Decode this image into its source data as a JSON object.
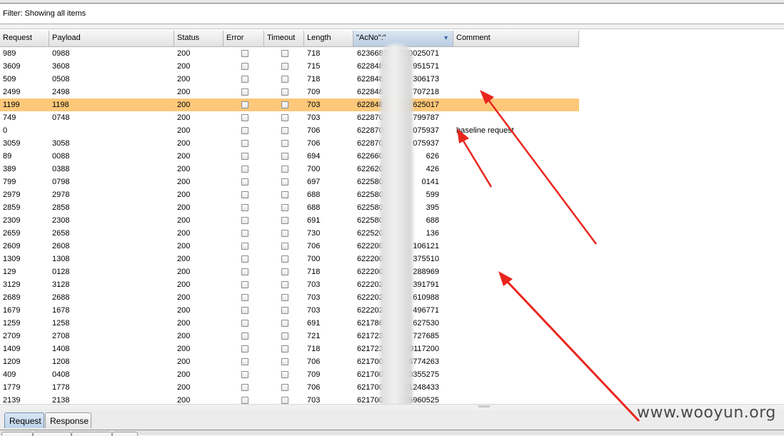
{
  "filter": {
    "label": "Filter: Showing all items"
  },
  "columns": [
    "Request",
    "Payload",
    "Status",
    "Error",
    "Timeout",
    "Length",
    "\"AcNo\":\"",
    "Comment"
  ],
  "selected_row_index": 4,
  "rows": [
    {
      "request": "989",
      "payload": "0988",
      "status": "200",
      "length": "718",
      "acno_start": "6236680",
      "acno_end": "020025071",
      "comment": ""
    },
    {
      "request": "3609",
      "payload": "3608",
      "status": "200",
      "length": "715",
      "acno_start": "6228481",
      "acno_end": "951571",
      "comment": ""
    },
    {
      "request": "509",
      "payload": "0508",
      "status": "200",
      "length": "718",
      "acno_start": "622848",
      "acno_end": "306173",
      "comment": ""
    },
    {
      "request": "2499",
      "payload": "2498",
      "status": "200",
      "length": "709",
      "acno_start": "622848",
      "acno_end": "707218",
      "comment": ""
    },
    {
      "request": "1199",
      "payload": "1198",
      "status": "200",
      "length": "703",
      "acno_start": "622848",
      "acno_end": "625017",
      "comment": ""
    },
    {
      "request": "749",
      "payload": "0748",
      "status": "200",
      "length": "703",
      "acno_start": "622870",
      "acno_end": "799787",
      "comment": ""
    },
    {
      "request": "0",
      "payload": "",
      "status": "200",
      "length": "706",
      "acno_start": "622870",
      "acno_end": "075937",
      "comment": "baseline request"
    },
    {
      "request": "3059",
      "payload": "3058",
      "status": "200",
      "length": "706",
      "acno_start": "622870",
      "acno_end": "075937",
      "comment": ""
    },
    {
      "request": "89",
      "payload": "0088",
      "status": "200",
      "length": "694",
      "acno_start": "622660",
      "acno_end": "626",
      "comment": ""
    },
    {
      "request": "389",
      "payload": "0388",
      "status": "200",
      "length": "700",
      "acno_start": "622620",
      "acno_end": "426",
      "comment": ""
    },
    {
      "request": "799",
      "payload": "0798",
      "status": "200",
      "length": "697",
      "acno_start": "622580",
      "acno_end": "0141",
      "comment": ""
    },
    {
      "request": "2979",
      "payload": "2978",
      "status": "200",
      "length": "688",
      "acno_start": "622580",
      "acno_end": "599",
      "comment": ""
    },
    {
      "request": "2859",
      "payload": "2858",
      "status": "200",
      "length": "688",
      "acno_start": "622580",
      "acno_end": "395",
      "comment": ""
    },
    {
      "request": "2309",
      "payload": "2308",
      "status": "200",
      "length": "691",
      "acno_start": "622580",
      "acno_end": "688",
      "comment": ""
    },
    {
      "request": "2659",
      "payload": "2658",
      "status": "200",
      "length": "730",
      "acno_start": "622520",
      "acno_end": "136",
      "comment": ""
    },
    {
      "request": "2609",
      "payload": "2608",
      "status": "200",
      "length": "706",
      "acno_start": "622200",
      "acno_end": "106121",
      "comment": ""
    },
    {
      "request": "1309",
      "payload": "1308",
      "status": "200",
      "length": "700",
      "acno_start": "622200",
      "acno_end": "375510",
      "comment": ""
    },
    {
      "request": "129",
      "payload": "0128",
      "status": "200",
      "length": "718",
      "acno_start": "622200",
      "acno_end": "288969",
      "comment": ""
    },
    {
      "request": "3129",
      "payload": "3128",
      "status": "200",
      "length": "703",
      "acno_start": "622202",
      "acno_end": "391791",
      "comment": ""
    },
    {
      "request": "2689",
      "payload": "2688",
      "status": "200",
      "length": "703",
      "acno_start": "622202",
      "acno_end": "610988",
      "comment": ""
    },
    {
      "request": "1679",
      "payload": "1678",
      "status": "200",
      "length": "703",
      "acno_start": "622202",
      "acno_end": "496771",
      "comment": ""
    },
    {
      "request": "1259",
      "payload": "1258",
      "status": "200",
      "length": "691",
      "acno_start": "621786",
      "acno_end": "627530",
      "comment": ""
    },
    {
      "request": "2709",
      "payload": "2708",
      "status": "200",
      "length": "721",
      "acno_start": "621723",
      "acno_end": "727685",
      "comment": ""
    },
    {
      "request": "1409",
      "payload": "1408",
      "status": "200",
      "length": "718",
      "acno_start": "621723",
      "acno_end": "0117200",
      "comment": ""
    },
    {
      "request": "1209",
      "payload": "1208",
      "status": "200",
      "length": "706",
      "acno_start": "621700",
      "acno_end": "6774263",
      "comment": ""
    },
    {
      "request": "409",
      "payload": "0408",
      "status": "200",
      "length": "709",
      "acno_start": "621700",
      "acno_end": "0355275",
      "comment": ""
    },
    {
      "request": "1779",
      "payload": "1778",
      "status": "200",
      "length": "706",
      "acno_start": "621700",
      "acno_end": "01248433",
      "comment": ""
    },
    {
      "request": "2139",
      "payload": "2138",
      "status": "200",
      "length": "703",
      "acno_start": "621700",
      "acno_end": "005960525",
      "comment": ""
    }
  ],
  "tabs": [
    {
      "label": "Request",
      "active": true
    },
    {
      "label": "Response",
      "active": false
    }
  ],
  "watermark": "www.wooyun.org",
  "colors": {
    "selected_row": "#fdc87a",
    "arrow": "#e8261e",
    "sorted_header": "#b9cde3"
  }
}
